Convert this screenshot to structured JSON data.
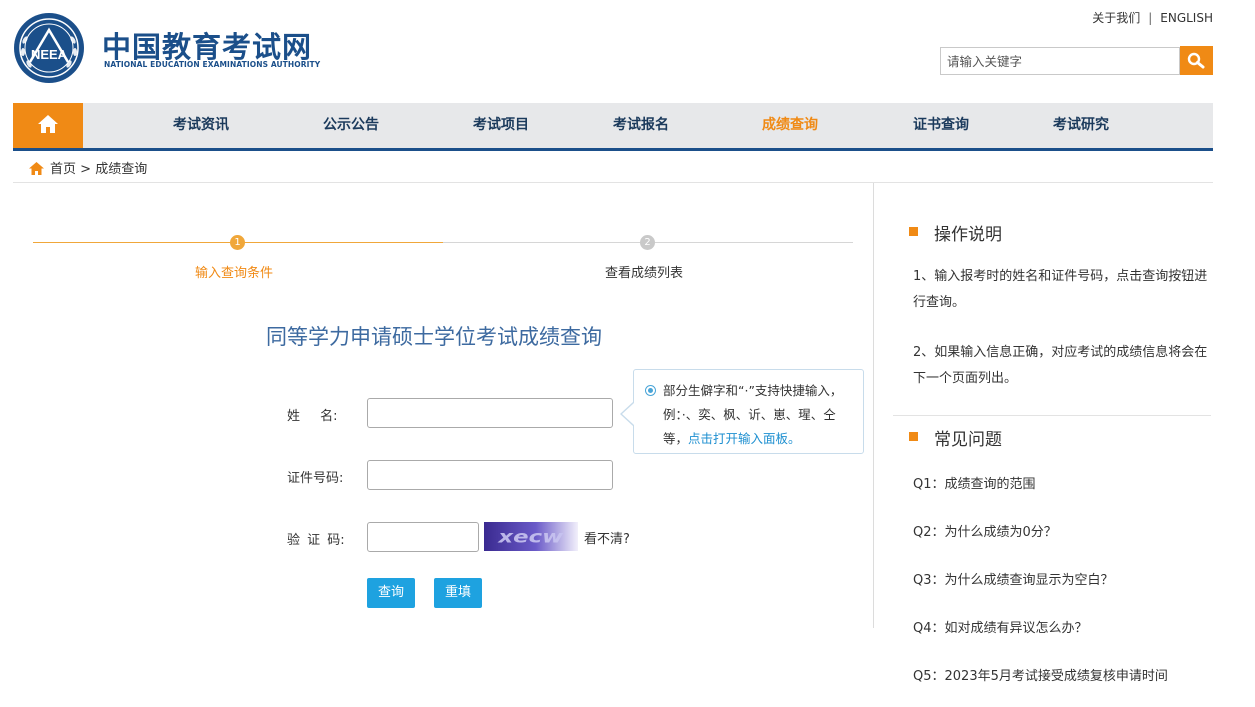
{
  "header": {
    "logo_cn": "中国教育考试网",
    "logo_en": "NATIONAL EDUCATION EXAMINATIONS AUTHORITY",
    "logo_emblem_text": "NEEA",
    "about_label": "关于我们",
    "separator": "|",
    "english_label": "ENGLISH",
    "search_placeholder": "请输入关键字"
  },
  "nav": {
    "items": [
      {
        "label": "考试资讯"
      },
      {
        "label": "公示公告"
      },
      {
        "label": "考试项目"
      },
      {
        "label": "考试报名"
      },
      {
        "label": "成绩查询"
      },
      {
        "label": "证书查询"
      },
      {
        "label": "考试研究"
      }
    ],
    "active_item": "成绩查询"
  },
  "breadcrumb": {
    "home": "首页",
    "separator": ">",
    "current": "成绩查询"
  },
  "steps": [
    {
      "number": "1",
      "label": "输入查询条件",
      "active": true
    },
    {
      "number": "2",
      "label": "查看成绩列表",
      "active": false
    }
  ],
  "form": {
    "title": "同等学力申请硕士学位考试成绩查询",
    "name_label": "姓 名:",
    "id_label": "证件号码:",
    "captcha_label": "验 证 码:",
    "captcha_text": "xecw",
    "captcha_refresh": "看不清?",
    "submit_label": "查询",
    "reset_label": "重填",
    "tip_text": "部分生僻字和“·”支持快捷输入，例：·、奕、枫、䜣、崽、瑆、仝等，",
    "tip_link": "点击打开输入面板。"
  },
  "sidebar": {
    "instructions_title": "操作说明",
    "instructions": [
      "1、输入报考时的姓名和证件号码，点击查询按钮进行查询。",
      "2、如果输入信息正确，对应考试的成绩信息将会在下一个页面列出。"
    ],
    "faq_title": "常见问题",
    "faq": [
      "Q1：成绩查询的范围",
      "Q2：为什么成绩为0分？",
      "Q3：为什么成绩查询显示为空白？",
      "Q4：如对成绩有异议怎么办？",
      "Q5：2023年5月考试接受成绩复核申请时间"
    ]
  },
  "colors": {
    "brand_blue": "#1b4f8a",
    "accent_orange": "#f08a15",
    "button_blue": "#1ea2e0",
    "link_blue": "#1d8fd0"
  }
}
